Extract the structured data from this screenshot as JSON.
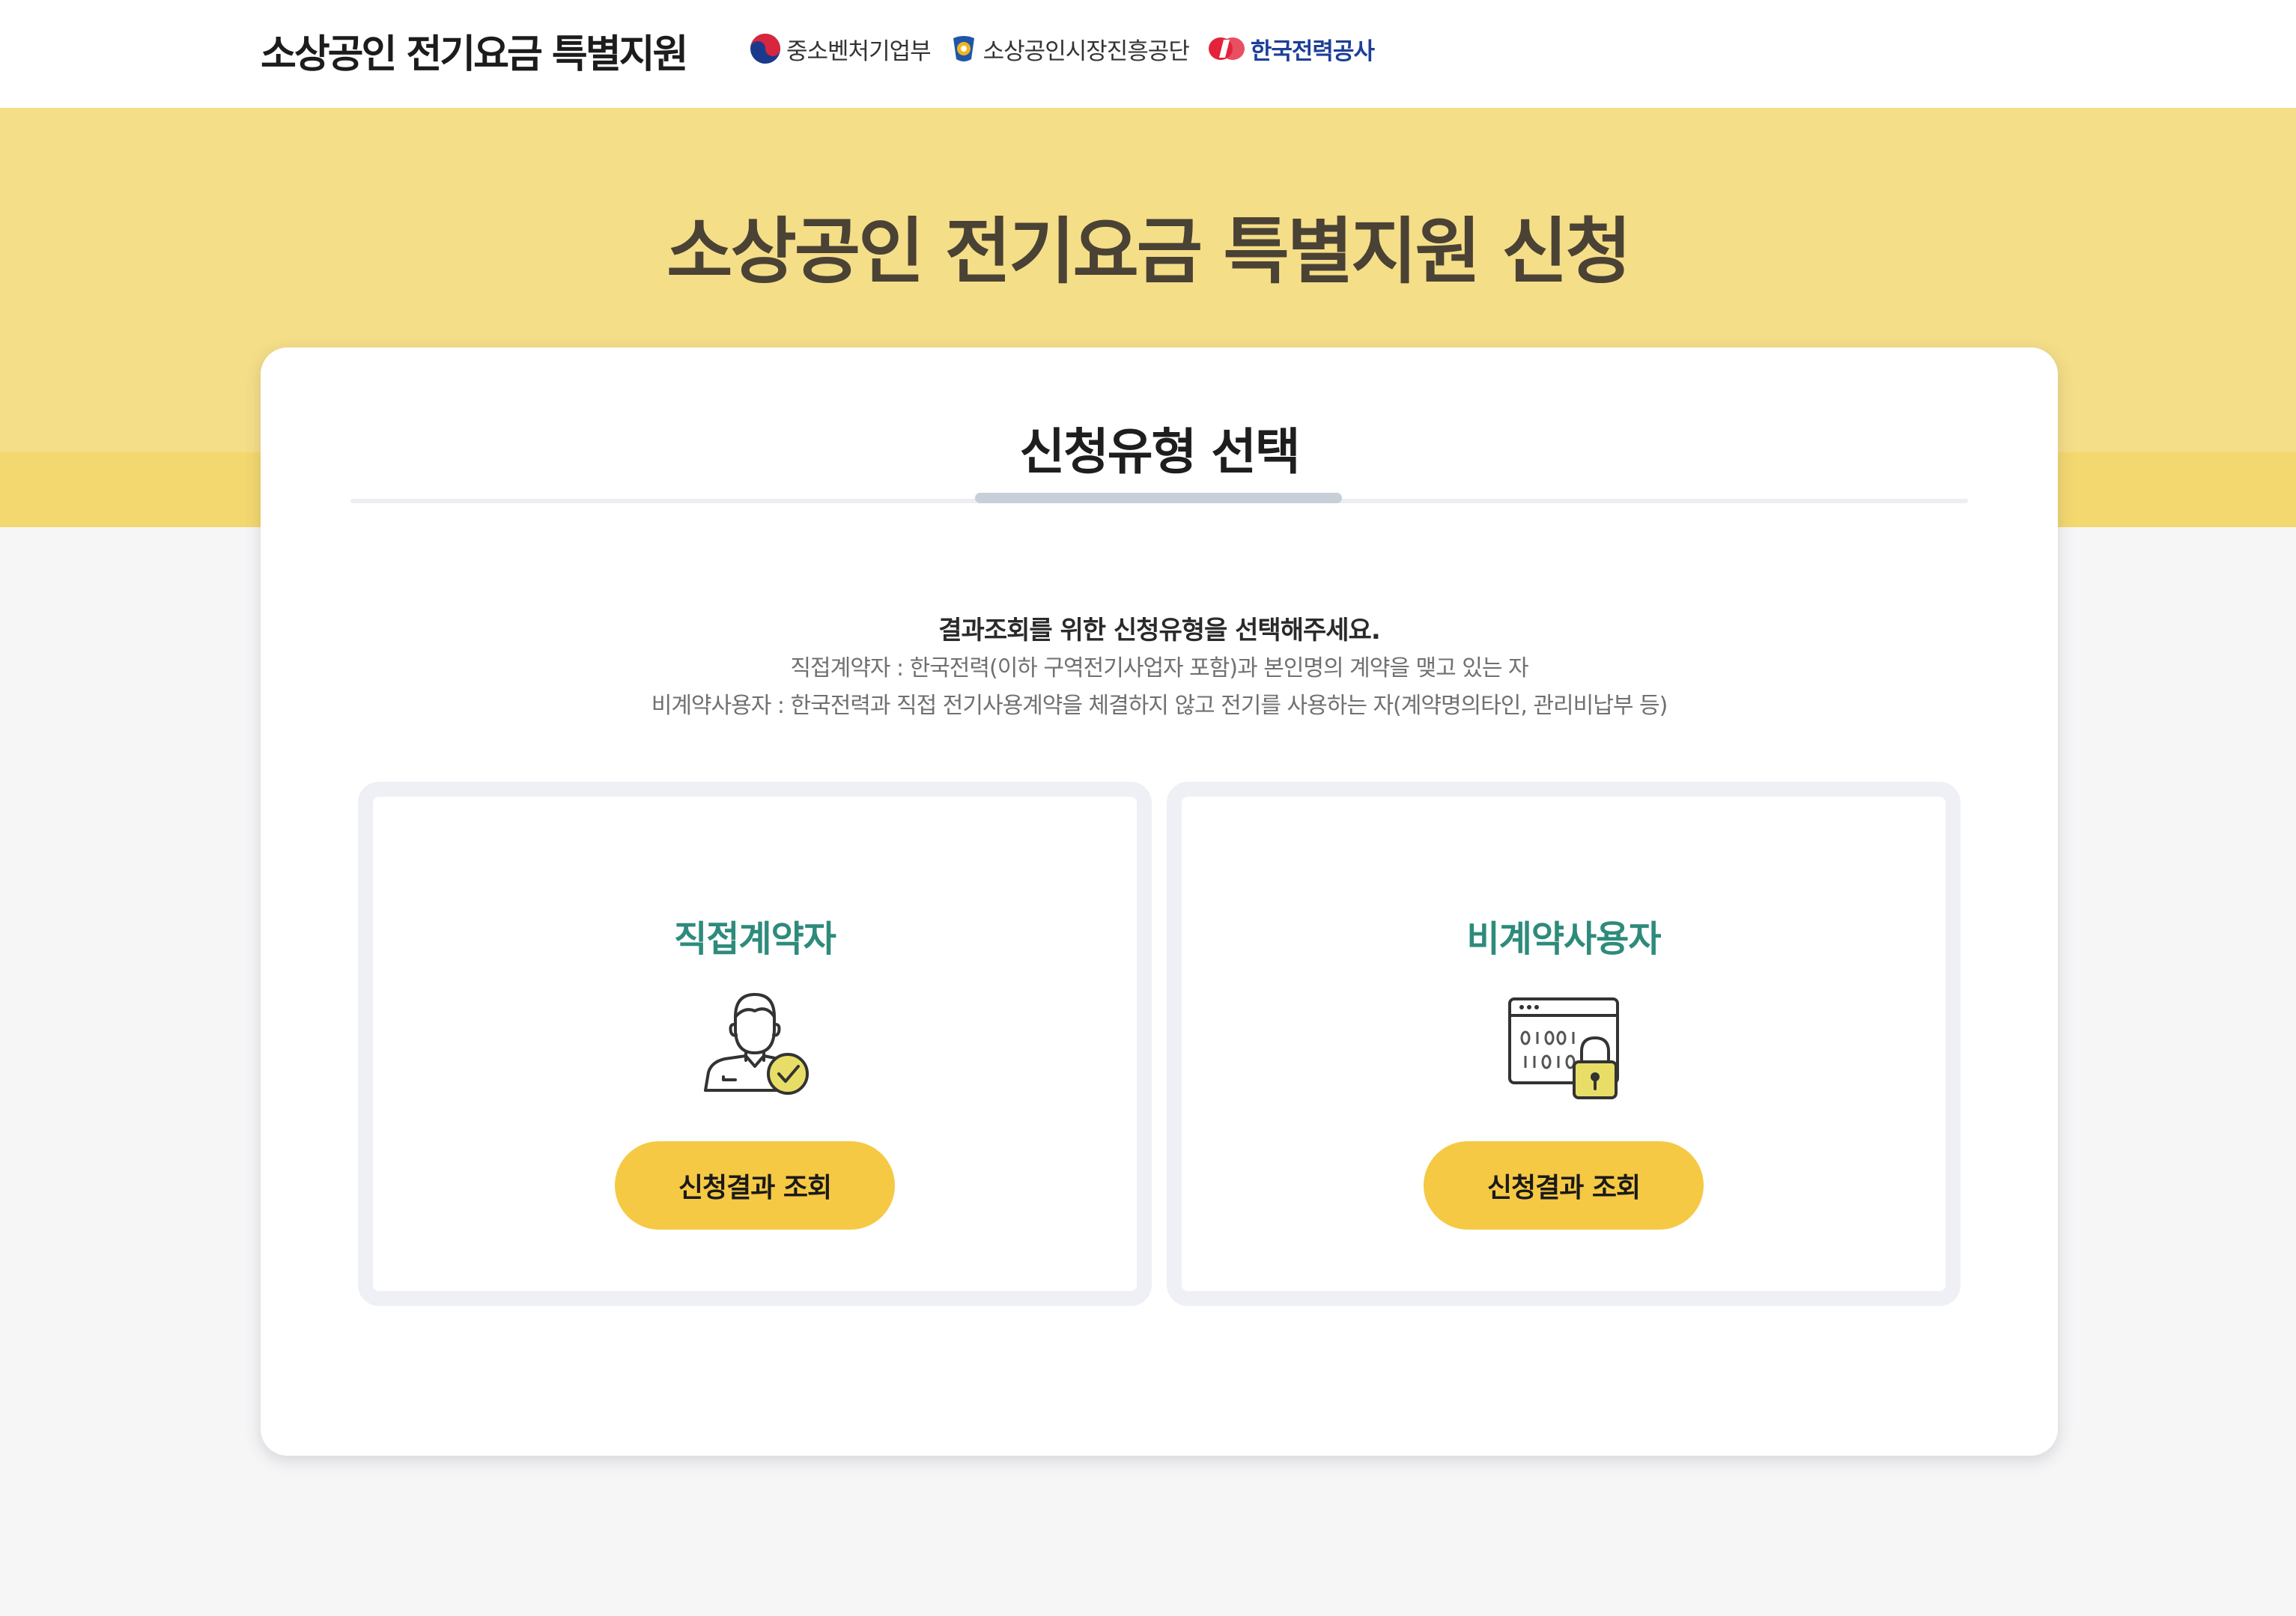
{
  "header": {
    "site_title": "소상공인 전기요금 특별지원",
    "partners": [
      {
        "name": "중소벤처기업부",
        "icon": "taegeuk-emblem-icon"
      },
      {
        "name": "소상공인시장진흥공단",
        "icon": "semas-logo-icon"
      },
      {
        "name": "한국전력공사",
        "icon": "kepco-logo-icon"
      }
    ]
  },
  "hero": {
    "title": "소상공인 전기요금 특별지원 신청"
  },
  "card": {
    "title": "신청유형 선택",
    "intro": {
      "main": "결과조회를 위한 신청유형을 선택해주세요.",
      "lines": [
        "직접계약자 : 한국전력(이하 구역전기사업자 포함)과 본인명의 계약을 맺고 있는 자",
        "비계약사용자 : 한국전력과 직접 전기사용계약을 체결하지 않고 전기를 사용하는 자(계약명의타인, 관리비납부 등)"
      ]
    },
    "options": [
      {
        "title": "직접계약자",
        "icon": "user-check-icon",
        "button_label": "신청결과 조회"
      },
      {
        "title": "비계약사용자",
        "icon": "binary-lock-icon",
        "button_label": "신청결과 조회"
      }
    ]
  },
  "colors": {
    "hero_bg": "#f5de88",
    "hero_band": "#f3d86f",
    "accent_button": "#f6c944",
    "option_title": "#2e8b7c",
    "kepco_blue": "#1d3f97",
    "kepco_red": "#e2233a"
  }
}
